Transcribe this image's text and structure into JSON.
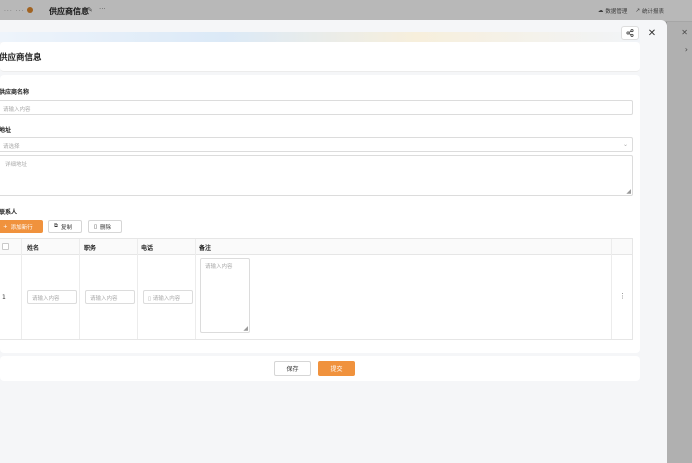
{
  "app": {
    "title": "供应商信息",
    "links": [
      "数据管理",
      "统计报表"
    ],
    "window_dots": "··· ···"
  },
  "modal": {
    "title": "供应商信息",
    "share_icon": "share-icon",
    "close_glyph": "✕"
  },
  "form": {
    "name_label": "供应商名称",
    "name_placeholder": "请输入内容",
    "address_label": "地址",
    "address_select_placeholder": "请选择",
    "address_detail_placeholder": "详细地址",
    "contacts_label": "联系人"
  },
  "toolbar": {
    "add_label": "添加新行",
    "copy_label": "复制",
    "delete_label": "删除"
  },
  "table": {
    "headers": [
      "姓名",
      "职务",
      "电话",
      "备注"
    ],
    "rows": [
      {
        "index": "1",
        "name_placeholder": "请输入内容",
        "title_placeholder": "请输入内容",
        "phone_placeholder": "请输入内容",
        "note_placeholder": "请输入内容"
      }
    ]
  },
  "footer": {
    "save_label": "保存",
    "submit_label": "提交"
  },
  "colors": {
    "accent": "#f0923d"
  }
}
